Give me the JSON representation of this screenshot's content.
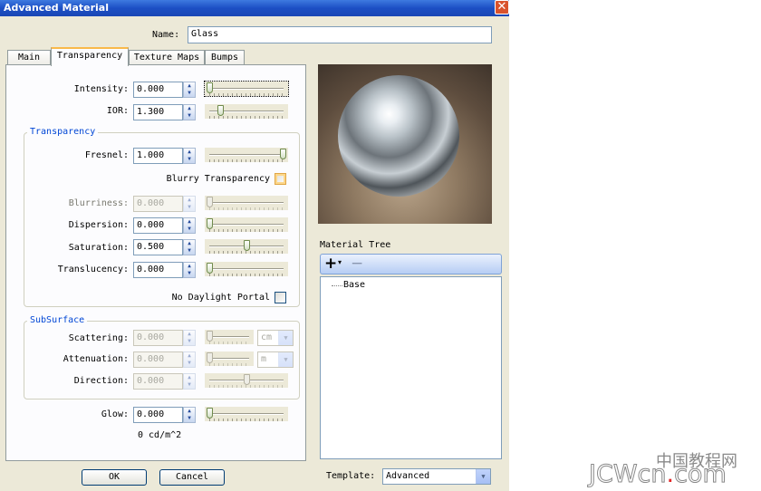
{
  "window": {
    "title": "Advanced Material",
    "close_glyph": "✕"
  },
  "name": {
    "label": "Name:",
    "value": "Glass"
  },
  "tabs": [
    {
      "label": "Main"
    },
    {
      "label": "Transparency"
    },
    {
      "label": "Texture Maps"
    },
    {
      "label": "Bumps"
    }
  ],
  "fields": {
    "intensity": {
      "label": "Intensity:",
      "value": "0.000",
      "level": 0.0
    },
    "ior": {
      "label": "IOR:",
      "value": "1.300",
      "level": 0.15
    }
  },
  "transparency_group": {
    "title": "Transparency",
    "fresnel": {
      "label": "Fresnel:",
      "value": "1.000",
      "level": 1.0
    },
    "blurry": {
      "label": "Blurry Transparency",
      "checked": false
    },
    "blurriness": {
      "label": "Blurriness:",
      "value": "0.000",
      "level": 0.0
    },
    "dispersion": {
      "label": "Dispersion:",
      "value": "0.000",
      "level": 0.0
    },
    "saturation": {
      "label": "Saturation:",
      "value": "0.500",
      "level": 0.5
    },
    "translucency": {
      "label": "Translucency:",
      "value": "0.000",
      "level": 0.0
    },
    "no_daylight": {
      "label": "No Daylight Portal",
      "checked": false
    }
  },
  "subsurface_group": {
    "title": "SubSurface",
    "scattering": {
      "label": "Scattering:",
      "value": "0.000",
      "unit": "cm",
      "level": 0.0
    },
    "attenuation": {
      "label": "Attenuation:",
      "value": "0.000",
      "unit": "m",
      "level": 0.0
    },
    "direction": {
      "label": "Direction:",
      "value": "0.000",
      "level": 0.5
    }
  },
  "glow": {
    "label": "Glow:",
    "value": "0.000",
    "level": 0.0,
    "unit_text": "0 cd/m^2"
  },
  "material_tree": {
    "title": "Material Tree",
    "add_glyph": "+",
    "add_arrow": "▾",
    "remove_glyph": "−",
    "items": [
      {
        "label": "Base"
      }
    ]
  },
  "template": {
    "label": "Template:",
    "value": "Advanced"
  },
  "buttons": {
    "ok": "OK",
    "cancel": "Cancel"
  },
  "watermark": {
    "line1": "中国教程网",
    "line2a": "JCWcn",
    "line2b": ".com"
  },
  "colors": {
    "title_bar": "#1c4fc4",
    "group_title": "#0046d5",
    "tab_highlight": "#f9b94a"
  }
}
